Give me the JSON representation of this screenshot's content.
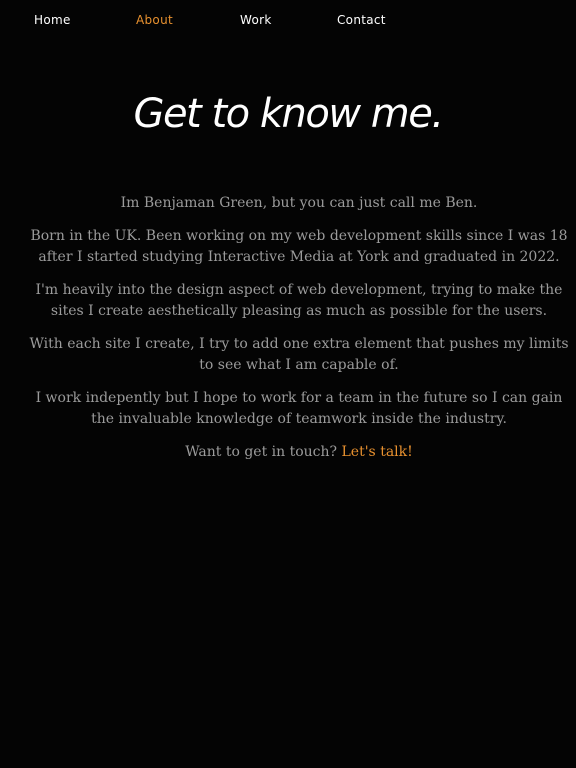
{
  "nav": {
    "items": [
      {
        "label": "Home"
      },
      {
        "label": "About"
      },
      {
        "label": "Work"
      },
      {
        "label": "Contact"
      }
    ]
  },
  "page": {
    "title": "Get to know me."
  },
  "about": {
    "paragraphs": [
      "Im Benjaman Green, but you can just call me Ben.",
      "Born in the UK. Been working on my web development skills since I was 18 after I started studying Interactive Media at York and graduated in 2022.",
      "I'm heavily into the design aspect of web development, trying to make the sites I create aesthetically pleasing as much as possible for the users.",
      "With each site I create, I try to add one extra element that pushes my limits to see what I am capable of.",
      "I work indepently but I hope to work for a team in the future so I can gain the invaluable knowledge of teamwork inside the industry."
    ],
    "cta": {
      "prompt": "Want to get in touch?",
      "link_label": "Let's talk!"
    }
  },
  "colors": {
    "background": "#040404",
    "accent": "#e8912f",
    "body_text": "#9b9b9b",
    "heading": "#ffffff"
  }
}
